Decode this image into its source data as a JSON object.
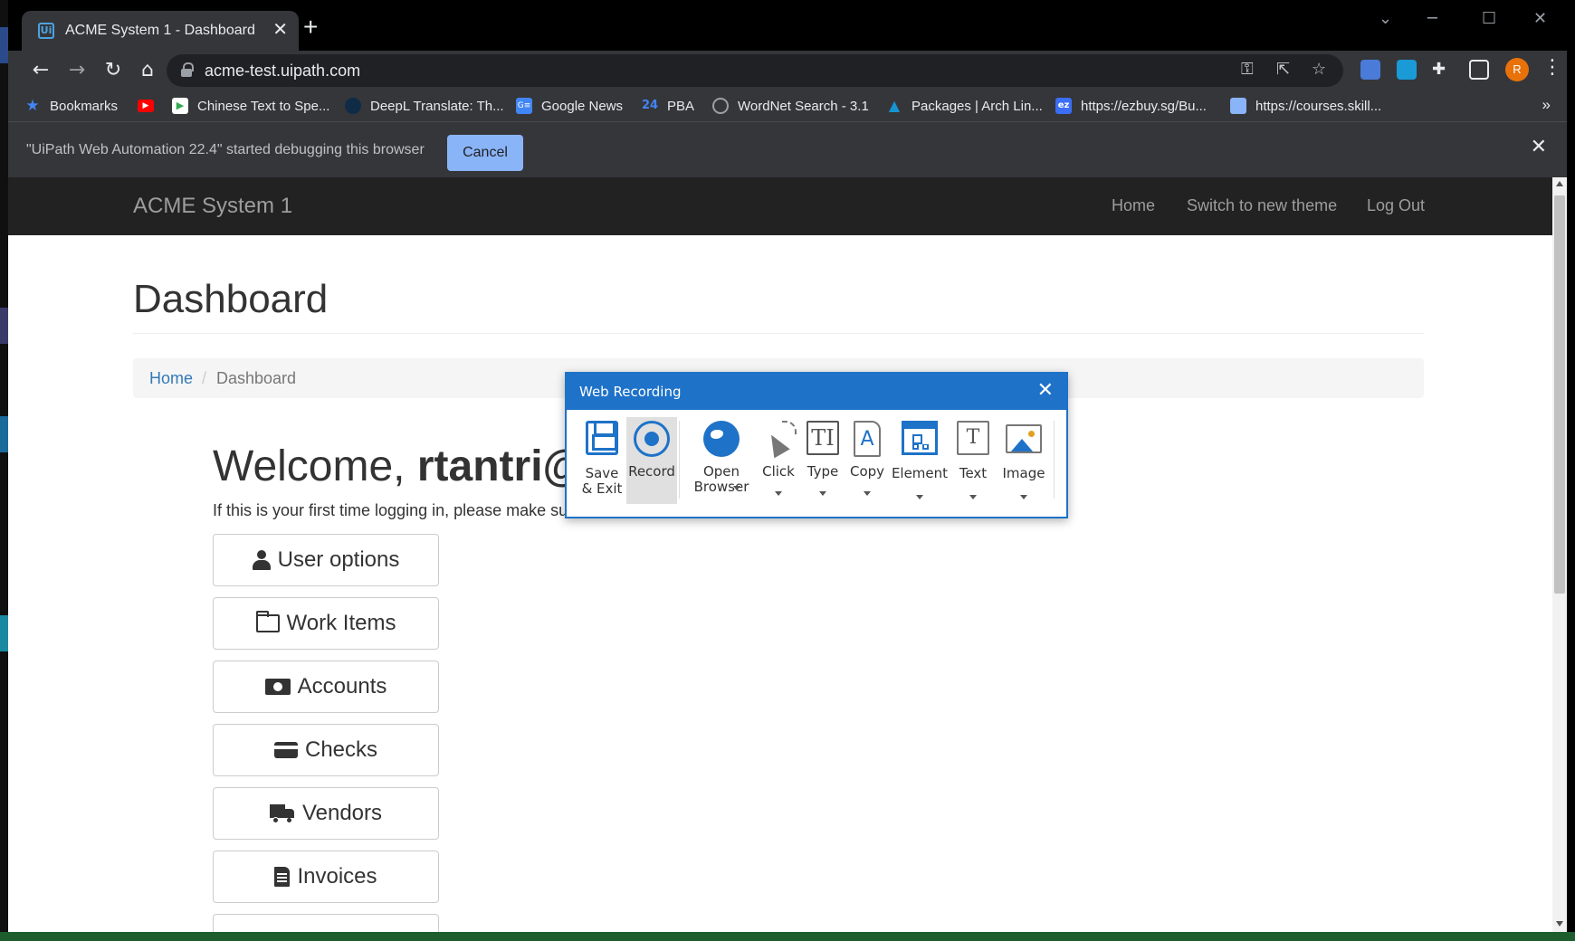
{
  "browser": {
    "tab_title": "ACME System 1 - Dashboard",
    "tab_icon_text": "Ui",
    "new_tab_symbol": "+",
    "tab_close_symbol": "✕",
    "url": "acme-test.uipath.com",
    "profile_initial": "R",
    "bookmarks": [
      {
        "label": "Bookmarks",
        "icon": "star-icon",
        "color": "#4285f4"
      },
      {
        "label": "",
        "icon": "youtube-icon",
        "color": "#ff0000"
      },
      {
        "label": "Chinese Text to Spe...",
        "icon": "play-icon",
        "color": "#34a853"
      },
      {
        "label": "DeepL Translate: Th...",
        "icon": "deepl-icon",
        "color": "#0f2b46"
      },
      {
        "label": "Google News",
        "icon": "news-icon",
        "color": "#4285f4"
      },
      {
        "label": "PBA",
        "icon": "pba-icon",
        "color": "#4285f4"
      },
      {
        "label": "WordNet Search - 3.1",
        "icon": "globe-icon",
        "color": "#9aa0a6"
      },
      {
        "label": "Packages | Arch Lin...",
        "icon": "arch-icon",
        "color": "#1793d1"
      },
      {
        "label": "https://ezbuy.sg/Bu...",
        "icon": "ezbuy-icon",
        "color": "#3b6ef5"
      },
      {
        "label": "https://courses.skill...",
        "icon": "page-icon",
        "color": "#8ab4f8"
      }
    ],
    "bookmarks_overflow": "»",
    "infobar_text": "\"UiPath Web Automation 22.4\" started debugging this browser",
    "infobar_cancel": "Cancel"
  },
  "site": {
    "brand": "ACME System 1",
    "nav": [
      "Home",
      "Switch to new theme",
      "Log Out"
    ],
    "page_title": "Dashboard",
    "breadcrumb": {
      "home": "Home",
      "separator": "/",
      "current": "Dashboard"
    },
    "welcome_prefix": "Welcome, ",
    "welcome_user": "rtantri@",
    "first_time_text": "If this is your first time logging in, please make sur",
    "buttons": [
      {
        "label": "User options",
        "icon": "user-icon"
      },
      {
        "label": "Work Items",
        "icon": "folder-icon"
      },
      {
        "label": "Accounts",
        "icon": "money-icon"
      },
      {
        "label": "Checks",
        "icon": "credit-card-icon"
      },
      {
        "label": "Vendors",
        "icon": "truck-icon"
      },
      {
        "label": "Invoices",
        "icon": "file-icon"
      }
    ]
  },
  "recorder": {
    "title": "Web Recording",
    "close_symbol": "✕",
    "tools": {
      "save": "Save\n& Exit",
      "record": "Record",
      "open_browser": "Open\nBrowser",
      "click": "Click",
      "type": "Type",
      "copy": "Copy",
      "element": "Element",
      "text": "Text",
      "image": "Image"
    },
    "accent": "#1e72c8"
  }
}
